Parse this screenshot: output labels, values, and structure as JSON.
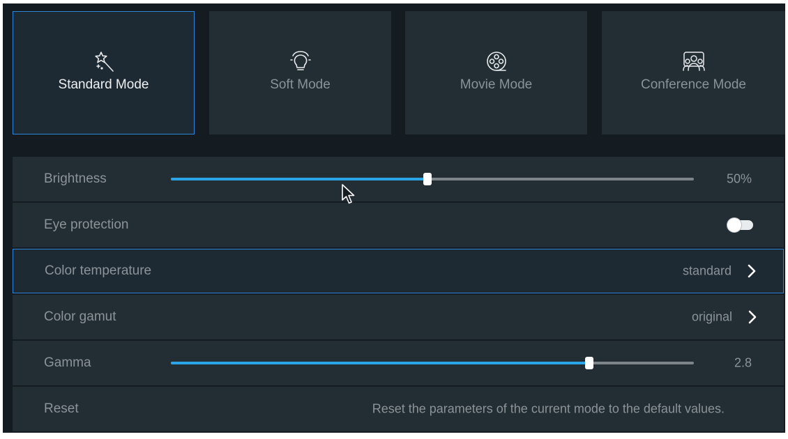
{
  "modes": [
    {
      "label": "Standard Mode",
      "icon": "magic-wand-icon",
      "selected": true
    },
    {
      "label": "Soft Mode",
      "icon": "lightbulb-icon",
      "selected": false
    },
    {
      "label": "Movie Mode",
      "icon": "film-reel-icon",
      "selected": false
    },
    {
      "label": "Conference Mode",
      "icon": "conference-people-icon",
      "selected": false
    }
  ],
  "settings": {
    "brightness": {
      "label": "Brightness",
      "value_text": "50%",
      "level": 0.49
    },
    "eye_protection": {
      "label": "Eye protection",
      "enabled": false
    },
    "color_temperature": {
      "label": "Color temperature",
      "value": "standard"
    },
    "color_gamut": {
      "label": "Color gamut",
      "value": "original"
    },
    "gamma": {
      "label": "Gamma",
      "value_text": "2.8",
      "level": 0.8
    },
    "reset": {
      "label": "Reset",
      "description": "Reset the parameters of the current mode to the default values."
    }
  },
  "colors": {
    "accent": "#2aa5e8",
    "selection_border": "#2f86d8",
    "panel_bg": "#141c22",
    "card_bg": "#232d34"
  }
}
